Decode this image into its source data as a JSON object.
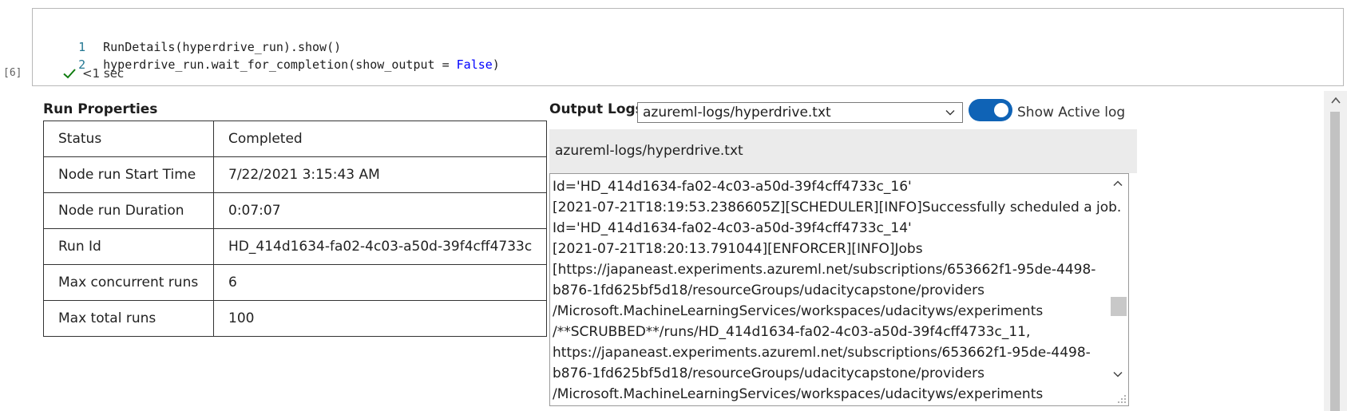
{
  "cell": {
    "execution_count": "[6]",
    "code_lines": [
      {
        "num": "1",
        "text": "RunDetails(hyperdrive_run).show()"
      },
      {
        "num": "2",
        "text_before": "hyperdrive_run.wait_for_completion(show_output = ",
        "keyword": "False",
        "text_after": ")"
      }
    ],
    "status": {
      "icon": "check-icon",
      "text": "<1 sec",
      "color": "#107c10"
    }
  },
  "run_properties": {
    "title": "Run Properties",
    "rows": [
      {
        "key": "Status",
        "value": "Completed"
      },
      {
        "key": "Node run Start Time",
        "value": "7/22/2021 3:15:43 AM"
      },
      {
        "key": "Node run Duration",
        "value": "0:07:07"
      },
      {
        "key": "Run Id",
        "value": "HD_414d1634-fa02-4c03-a50d-39f4cff4733c"
      },
      {
        "key": "Max concurrent runs",
        "value": "6"
      },
      {
        "key": "Max total runs",
        "value": "100"
      }
    ]
  },
  "output_logs": {
    "title": "Output Logs",
    "selected_log": "azureml-logs/hyperdrive.txt",
    "toggle_label": "Show Active log",
    "toggle_on": true,
    "toggle_color": "#0f63b6",
    "header": "azureml-logs/hyperdrive.txt",
    "lines": [
      "Id='HD_414d1634-fa02-4c03-a50d-39f4cff4733c_16'",
      "[2021-07-21T18:19:53.2386605Z][SCHEDULER][INFO]Successfully scheduled a job.",
      "Id='HD_414d1634-fa02-4c03-a50d-39f4cff4733c_14'",
      "[2021-07-21T18:20:13.791044][ENFORCER][INFO]Jobs",
      "[https://japaneast.experiments.azureml.net/subscriptions/653662f1-95de-4498-",
      "b876-1fd625bf5d18/resourceGroups/udacitycapstone/providers",
      "/Microsoft.MachineLearningServices/workspaces/udacityws/experiments",
      "/**SCRUBBED**/runs/HD_414d1634-fa02-4c03-a50d-39f4cff4733c_11,",
      "https://japaneast.experiments.azureml.net/subscriptions/653662f1-95de-4498-",
      "b876-1fd625bf5d18/resourceGroups/udacitycapstone/providers",
      "/Microsoft.MachineLearningServices/workspaces/udacityws/experiments"
    ]
  }
}
